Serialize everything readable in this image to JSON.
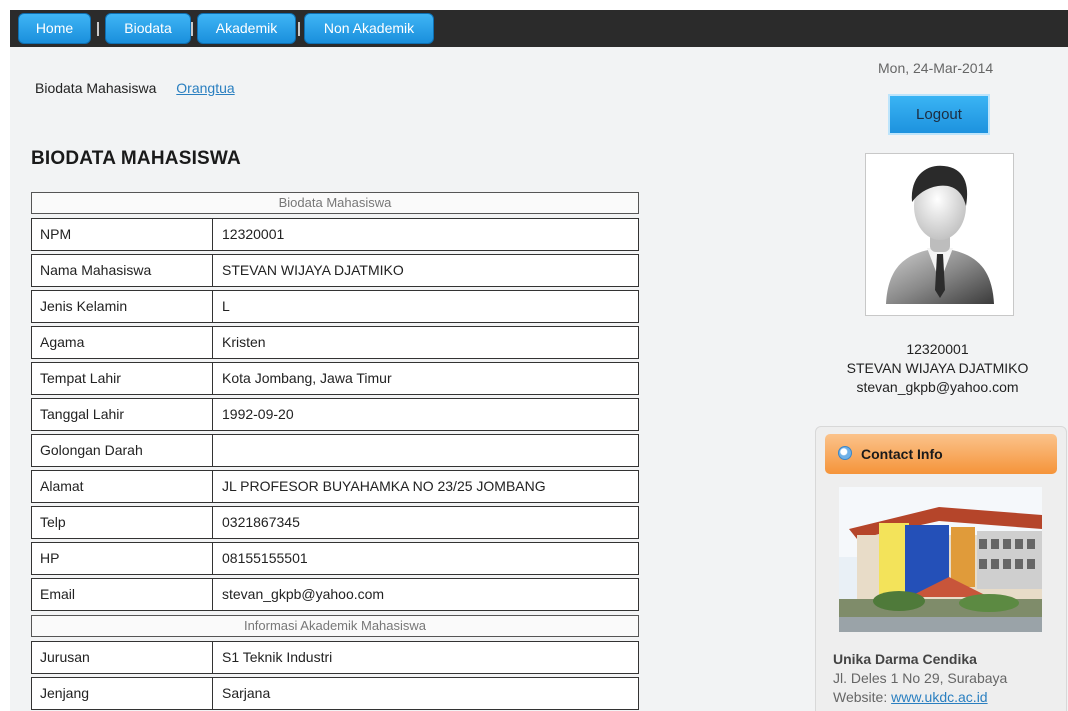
{
  "nav": {
    "items": [
      {
        "label": "Home"
      },
      {
        "label": "Biodata"
      },
      {
        "label": "Akademik"
      },
      {
        "label": "Non Akademik"
      }
    ]
  },
  "subnav": {
    "current": "Biodata Mahasiswa",
    "link": "Orangtua"
  },
  "page_title": "BIODATA MAHASISWA",
  "table": {
    "section1": "Biodata Mahasiswa",
    "rows1": [
      {
        "label": "NPM",
        "value": "12320001"
      },
      {
        "label": "Nama Mahasiswa",
        "value": "STEVAN WIJAYA DJATMIKO"
      },
      {
        "label": "Jenis Kelamin",
        "value": "L"
      },
      {
        "label": "Agama",
        "value": "Kristen"
      },
      {
        "label": "Tempat Lahir",
        "value": "Kota Jombang, Jawa Timur"
      },
      {
        "label": "Tanggal Lahir",
        "value": "1992-09-20"
      },
      {
        "label": "Golongan Darah",
        "value": ""
      },
      {
        "label": "Alamat",
        "value": "JL PROFESOR BUYAHAMKA NO 23/25 JOMBANG"
      },
      {
        "label": "Telp",
        "value": "0321867345"
      },
      {
        "label": "HP",
        "value": "08155155501"
      },
      {
        "label": "Email",
        "value": "stevan_gkpb@yahoo.com"
      }
    ],
    "section2": "Informasi Akademik Mahasiswa",
    "rows2": [
      {
        "label": "Jurusan",
        "value": "S1 Teknik Industri"
      },
      {
        "label": "Jenjang",
        "value": "Sarjana"
      }
    ]
  },
  "sidebar": {
    "date": "Mon, 24-Mar-2014",
    "logout_label": "Logout",
    "avatar_icon": "user-silhouette-icon",
    "user_id": "12320001",
    "user_name": "STEVAN WIJAYA DJATMIKO",
    "user_email": "stevan_gkpb@yahoo.com",
    "contact": {
      "title": "Contact Info",
      "org_name": "Unika Darma Cendika",
      "address": "Jl. Deles 1 No 29, Surabaya",
      "website_label": "Website:",
      "website_link": "www.ukdc.ac.id"
    }
  },
  "colors": {
    "nav_button": "#1a8fdc",
    "nav_bar": "#2b2b2b",
    "contact_header": "#f5943a",
    "link": "#2a7fc0"
  }
}
